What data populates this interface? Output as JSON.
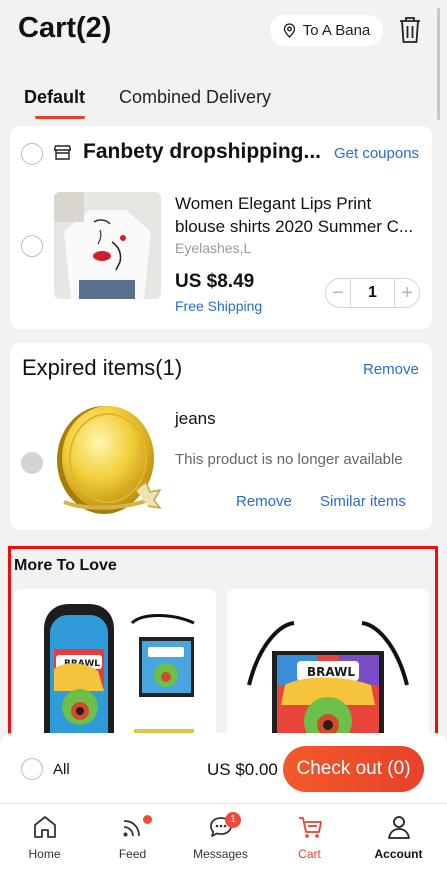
{
  "header": {
    "title": "Cart(2)",
    "location": "To A Bana"
  },
  "tabs": [
    {
      "label": "Default"
    },
    {
      "label": "Combined Delivery"
    }
  ],
  "store": {
    "name": "Fanbety dropshipping...",
    "coupons_label": "Get coupons",
    "item": {
      "title_line1": "Women Elegant Lips Print",
      "title_line2": "blouse shirts 2020 Summer C...",
      "variant": "Eyelashes,L",
      "price": "US $8.49",
      "shipping": "Free Shipping",
      "quantity": "1",
      "minus": "−",
      "plus": "+"
    }
  },
  "expired": {
    "title": "Expired items(1)",
    "remove_all": "Remove",
    "item": {
      "name": "jeans",
      "message": "This product is no longer available",
      "remove": "Remove",
      "similar": "Similar items"
    }
  },
  "more_to_love": {
    "title": "More To Love"
  },
  "checkout": {
    "all_label": "All",
    "total": "US $0.00",
    "button": "Check out (0)"
  },
  "nav": [
    {
      "label": "Home",
      "icon": "home-icon"
    },
    {
      "label": "Feed",
      "icon": "feed-icon"
    },
    {
      "label": "Messages",
      "icon": "messages-icon",
      "badge": "1"
    },
    {
      "label": "Cart",
      "icon": "cart-icon"
    },
    {
      "label": "Account",
      "icon": "account-icon"
    }
  ],
  "colors": {
    "accent": "#e8412a",
    "link": "#2a6ccf",
    "highlight_border": "#ee0d0d"
  }
}
